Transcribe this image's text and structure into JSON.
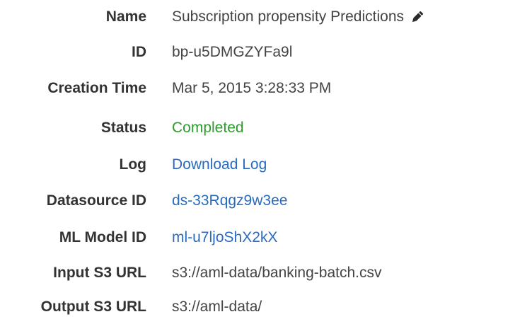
{
  "details": {
    "name": {
      "label": "Name",
      "value": "Subscription propensity Predictions"
    },
    "id": {
      "label": "ID",
      "value": "bp-u5DMGZYFa9l"
    },
    "creation_time": {
      "label": "Creation Time",
      "value": "Mar 5, 2015 3:28:33 PM"
    },
    "status": {
      "label": "Status",
      "value": "Completed"
    },
    "log": {
      "label": "Log",
      "value": "Download Log"
    },
    "datasource_id": {
      "label": "Datasource ID",
      "value": "ds-33Rqgz9w3ee"
    },
    "ml_model_id": {
      "label": "ML Model ID",
      "value": "ml-u7ljoShX2kX"
    },
    "input_s3_url": {
      "label": "Input S3 URL",
      "value": "s3://aml-data/banking-batch.csv"
    },
    "output_s3_url": {
      "label": "Output S3 URL",
      "value": "s3://aml-data/"
    }
  },
  "icons": {
    "edit": "pencil-icon"
  },
  "colors": {
    "label": "#333333",
    "value": "#444444",
    "status_completed": "#2e9a2e",
    "link": "#2a6bbf"
  }
}
